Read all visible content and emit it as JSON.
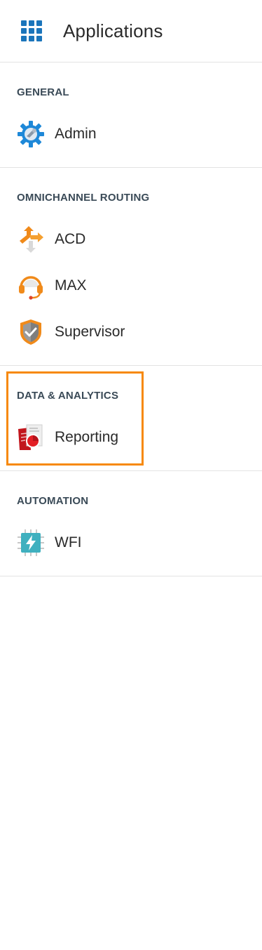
{
  "header": {
    "title": "Applications",
    "icon": "apps-grid-icon",
    "icon_color": "#1b75bb"
  },
  "sections": [
    {
      "title": "GENERAL",
      "items": [
        {
          "label": "Admin",
          "icon": "admin-gear-icon"
        }
      ]
    },
    {
      "title": "OMNICHANNEL ROUTING",
      "items": [
        {
          "label": "ACD",
          "icon": "acd-arrows-icon"
        },
        {
          "label": "MAX",
          "icon": "max-headset-icon"
        },
        {
          "label": "Supervisor",
          "icon": "supervisor-shield-icon"
        }
      ]
    },
    {
      "title": "DATA & ANALYTICS",
      "items": [
        {
          "label": "Reporting",
          "icon": "reporting-document-icon"
        }
      ]
    },
    {
      "title": "AUTOMATION",
      "items": [
        {
          "label": "WFI",
          "icon": "wfi-chip-icon"
        }
      ]
    }
  ],
  "colors": {
    "highlight": "#f7890a",
    "divider": "#e3e3e3",
    "section_title": "#3a4a57"
  }
}
